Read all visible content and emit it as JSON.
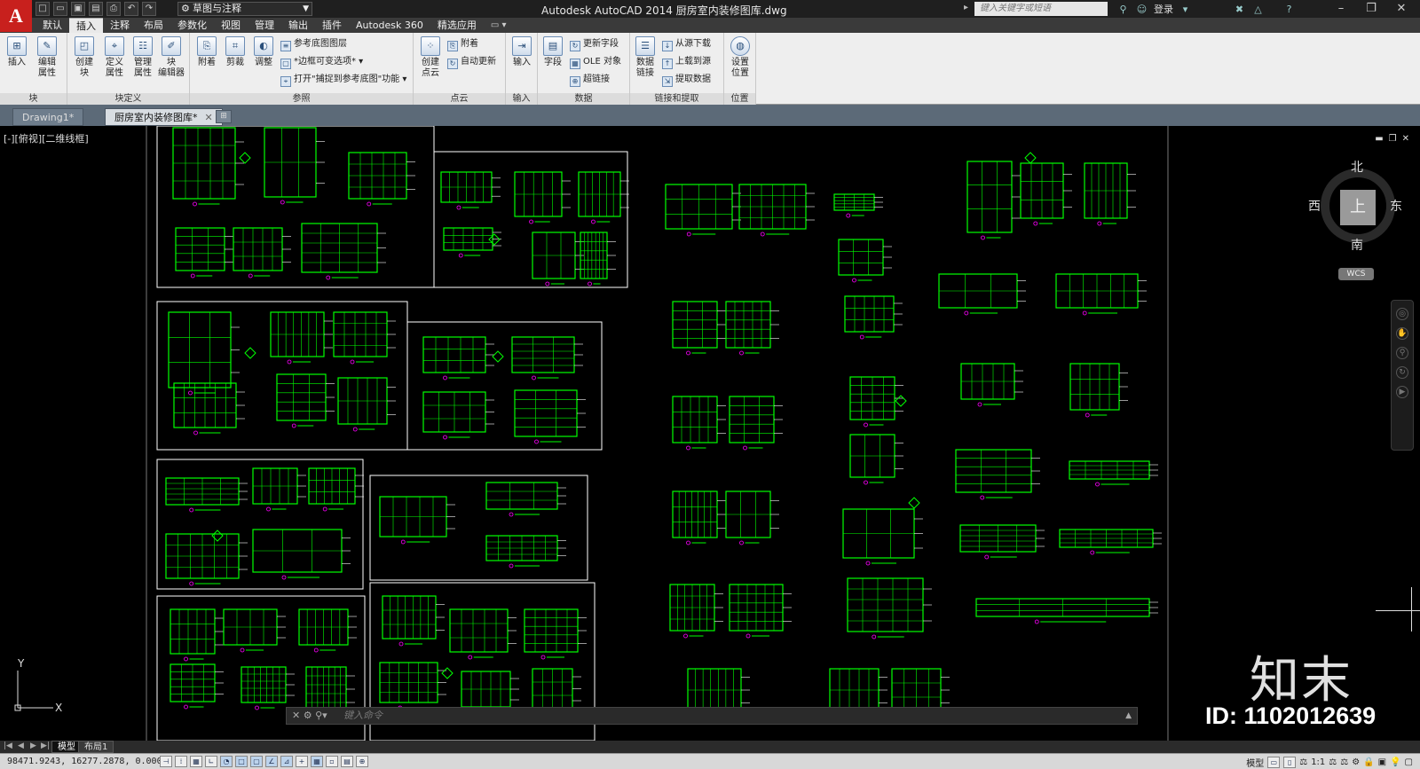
{
  "app": {
    "logo": "A",
    "workspace": "草图与注释",
    "title": "Autodesk AutoCAD 2014    厨房室内装修图库.dwg",
    "search_placeholder": "键入关键字或短语",
    "login": "登录"
  },
  "qat_icons": [
    "new-icon",
    "open-icon",
    "save-icon",
    "saveas-icon",
    "plot-icon",
    "undo-icon",
    "redo-icon"
  ],
  "ribbon_tabs": [
    "默认",
    "插入",
    "注释",
    "布局",
    "参数化",
    "视图",
    "管理",
    "输出",
    "插件",
    "Autodesk 360",
    "精选应用"
  ],
  "ribbon_tab_active": "插入",
  "ribbon": {
    "block": {
      "title": "块",
      "insert": "插入",
      "edit_attr": "编辑\n属性"
    },
    "block_def": {
      "title": "块定义",
      "create": "创建\n块",
      "define_attr": "定义\n属性",
      "manage_attr": "管理\n属性",
      "block_editor": "块\n编辑器"
    },
    "reference": {
      "title": "参照",
      "attach": "附着",
      "clip": "剪裁",
      "adjust": "调整",
      "underlay_layers": "参考底图图层",
      "frames": "*边框可变选项*",
      "snap": "打开\"捕捉到参考底图\"功能"
    },
    "point_cloud": {
      "title": "点云",
      "create": "创建\n点云",
      "attach": "附着",
      "auto_update": "自动更新"
    },
    "import": {
      "title": "输入",
      "import": "输入"
    },
    "data": {
      "title": "数据",
      "field": "字段",
      "update_fields": "更新字段",
      "ole": "OLE 对象",
      "hyperlink": "超链接"
    },
    "link_extract": {
      "title": "链接和提取",
      "data_link": "数据\n链接",
      "download": "从源下载",
      "upload": "上载到源",
      "extract": "提取数据"
    },
    "location": {
      "title": "位置",
      "set_location": "设置\n位置"
    }
  },
  "doc_tabs": [
    {
      "label": "Drawing1*",
      "active": false
    },
    {
      "label": "厨房室内装修图库*",
      "active": true
    }
  ],
  "canvas": {
    "viewport_label": "[-][俯视][二维线框]",
    "viewcube": {
      "north": "北",
      "south": "南",
      "east": "东",
      "west": "西",
      "face": "上",
      "wcs": "WCS"
    },
    "ucs_x": "X",
    "ucs_y": "Y",
    "cmd_prompt": "键入命令",
    "watermark": "知末",
    "watermark_id": "ID: 1102012639"
  },
  "layout_tabs": [
    {
      "label": "模型",
      "active": true
    },
    {
      "label": "布局1",
      "active": false
    }
  ],
  "status": {
    "coords": "98471.9243, 16277.2878, 0.0000",
    "model": "模型",
    "scale": "1:1"
  },
  "colors": {
    "drawing_line": "#00ff00",
    "frame_line": "#ffffff",
    "accent_magenta": "#ff00ff",
    "logo_red": "#c8201d"
  }
}
